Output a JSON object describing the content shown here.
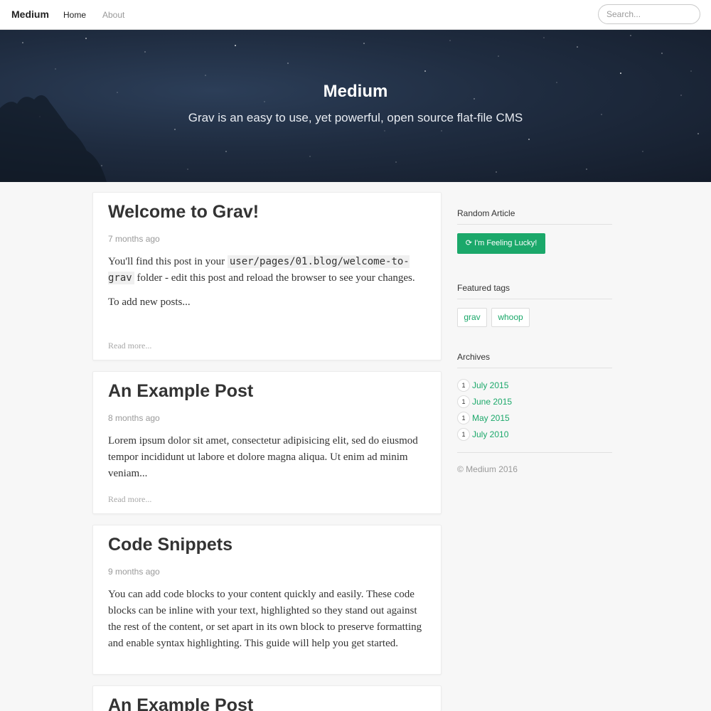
{
  "navbar": {
    "brand": "Medium",
    "links": [
      "Home",
      "About"
    ],
    "search_placeholder": "Search..."
  },
  "hero": {
    "title": "Medium",
    "subtitle": "Grav is an easy to use, yet powerful, open source flat-file CMS"
  },
  "posts": [
    {
      "title": "Welcome to Grav!",
      "date": "7 months ago",
      "body_prefix": "You'll find this post in your ",
      "body_code": "user/pages/01.blog/welcome-to-grav",
      "body_suffix": " folder - edit this post and reload the browser to see your changes.",
      "body_p2": "To add new posts...",
      "read_more": "Read more..."
    },
    {
      "title": "An Example Post",
      "date": "8 months ago",
      "body": "Lorem ipsum dolor sit amet, consectetur adipisicing elit, sed do eiusmod tempor incididunt ut labore et dolore magna aliqua. Ut enim ad minim veniam...",
      "read_more": "Read more..."
    },
    {
      "title": "Code Snippets",
      "date": "9 months ago",
      "body": "You can add code blocks to your content quickly and easily. These code blocks can be inline with your text, highlighted so they stand out against the rest of the content, or set apart in its own block to preserve formatting and enable syntax highlighting. This guide will help you get started."
    },
    {
      "title": "An Example Post"
    }
  ],
  "sidebar": {
    "random_heading": "Random Article",
    "lucky_button": "I'm Feeling Lucky!",
    "lucky_icon": "refresh-icon",
    "tags_heading": "Featured tags",
    "tags": [
      "grav",
      "whoop"
    ],
    "archives_heading": "Archives",
    "archives": [
      {
        "count": "1",
        "label": "July 2015"
      },
      {
        "count": "1",
        "label": "June 2015"
      },
      {
        "count": "1",
        "label": "May 2015"
      },
      {
        "count": "1",
        "label": "July 2010"
      }
    ],
    "copyright": "© Medium 2016"
  },
  "colors": {
    "accent": "#1ba86a",
    "hero_bg": "#1f2c40",
    "page_bg": "#f7f7f7"
  }
}
